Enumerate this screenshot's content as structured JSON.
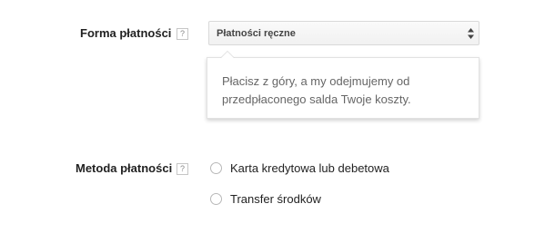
{
  "payment_form": {
    "label": "Forma płatności",
    "help_icon": "question-mark-icon",
    "help_glyph": "?",
    "select": {
      "selected": "Płatności ręczne",
      "arrow_icon": "sort-arrows-icon"
    },
    "info_bubble": {
      "text": "Płacisz z góry, a my odejmujemy od przedpłaconego salda Twoje koszty."
    }
  },
  "payment_method": {
    "label": "Metoda płatności",
    "help_icon": "question-mark-icon",
    "help_glyph": "?",
    "options": [
      {
        "label": "Karta kredytowa lub debetowa",
        "selected": false
      },
      {
        "label": "Transfer środków",
        "selected": false
      }
    ]
  }
}
